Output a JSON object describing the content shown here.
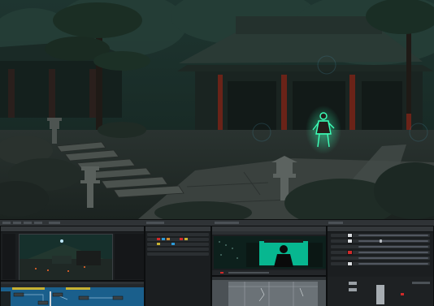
{
  "toolbar": {
    "tabs": [
      "",
      "",
      "",
      "",
      "",
      "",
      "",
      ""
    ]
  },
  "colors": {
    "accent": "#1ed69a",
    "timeline_blue": "#1c73b2",
    "clip_yellow": "#c8b233",
    "record_red": "#d12a2a",
    "panel_bg": "#1b1e20",
    "toolbar_bg": "#2f3336"
  },
  "icons": {
    "viewer_play": "play-icon",
    "node_graph": "node-graph-icon",
    "inspector": "sliders-icon"
  }
}
